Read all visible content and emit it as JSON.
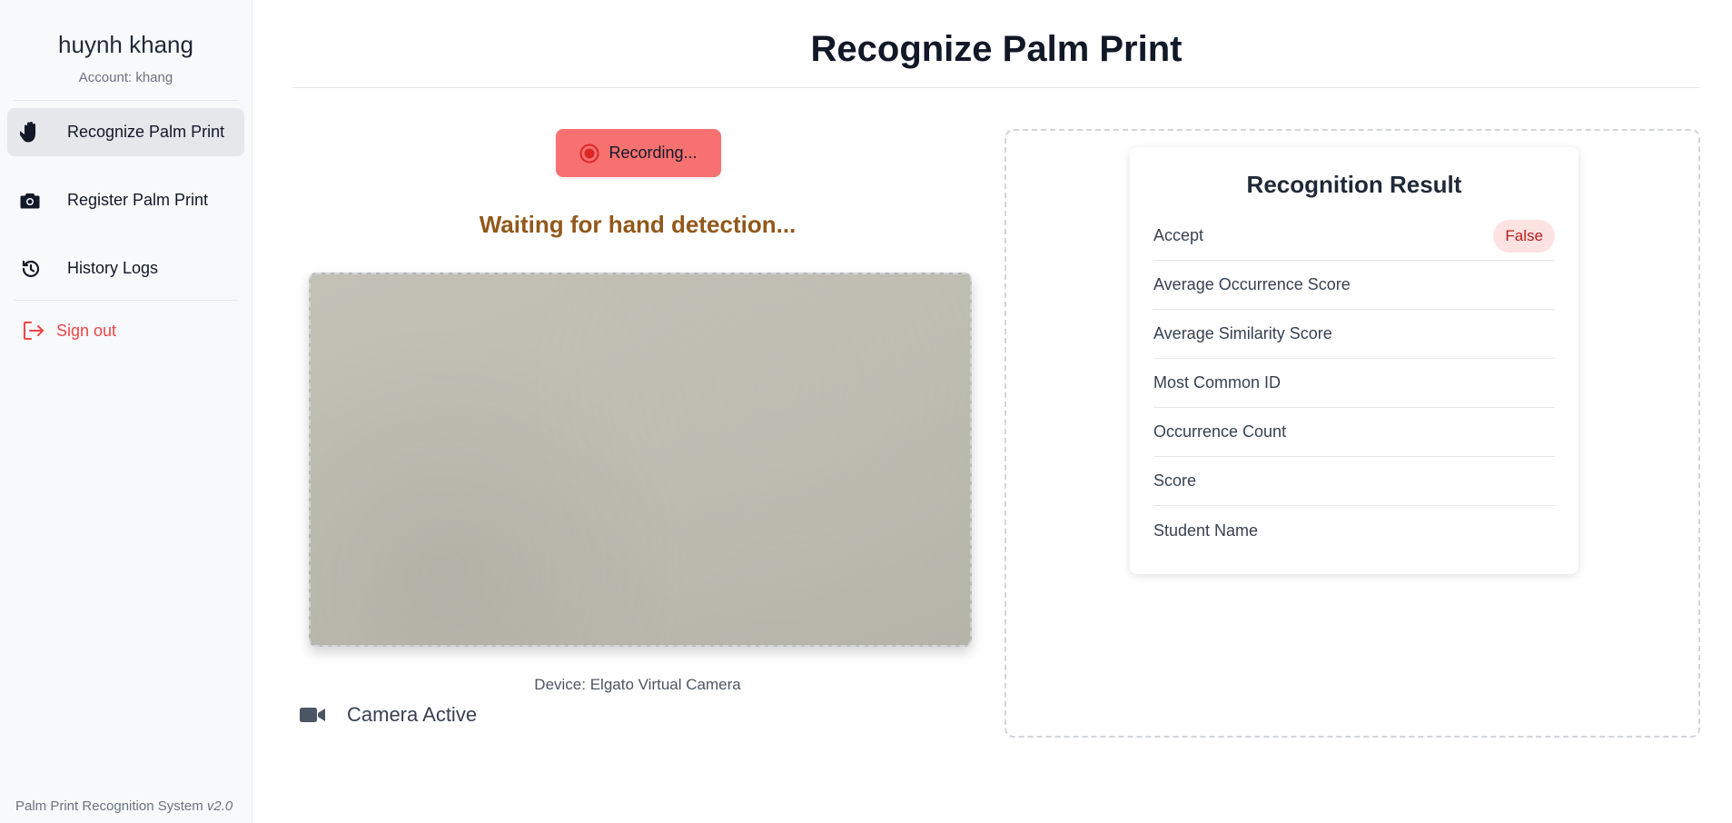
{
  "user": {
    "name": "huynh khang",
    "account": "Account: khang"
  },
  "sidebar": {
    "items": [
      {
        "label": "Recognize Palm Print",
        "icon": "hand-icon",
        "active": true
      },
      {
        "label": "Register Palm Print",
        "icon": "camera-icon",
        "active": false
      },
      {
        "label": "History Logs",
        "icon": "history-icon",
        "active": false
      }
    ],
    "signout": {
      "label": "Sign out",
      "icon": "sign-out-icon"
    },
    "footer": {
      "text": "Palm Print Recognition System",
      "version": "v2.0"
    }
  },
  "page": {
    "title": "Recognize Palm Print"
  },
  "capture": {
    "record_label": "Recording...",
    "status": "Waiting for hand detection...",
    "device": "Device: Elgato Virtual Camera",
    "camera_status": "Camera Active"
  },
  "result": {
    "title": "Recognition Result",
    "rows": [
      {
        "key": "Accept",
        "value": "False"
      },
      {
        "key": "Average Occurrence Score",
        "value": ""
      },
      {
        "key": "Average Similarity Score",
        "value": ""
      },
      {
        "key": "Most Common ID",
        "value": ""
      },
      {
        "key": "Occurrence Count",
        "value": ""
      },
      {
        "key": "Score",
        "value": ""
      },
      {
        "key": "Student Name",
        "value": ""
      }
    ]
  },
  "colors": {
    "recording": "#f87171",
    "waiting": "#92581a",
    "signout": "#ef4444",
    "badge_bg": "#fde2e2",
    "badge_text": "#b91c1c"
  }
}
